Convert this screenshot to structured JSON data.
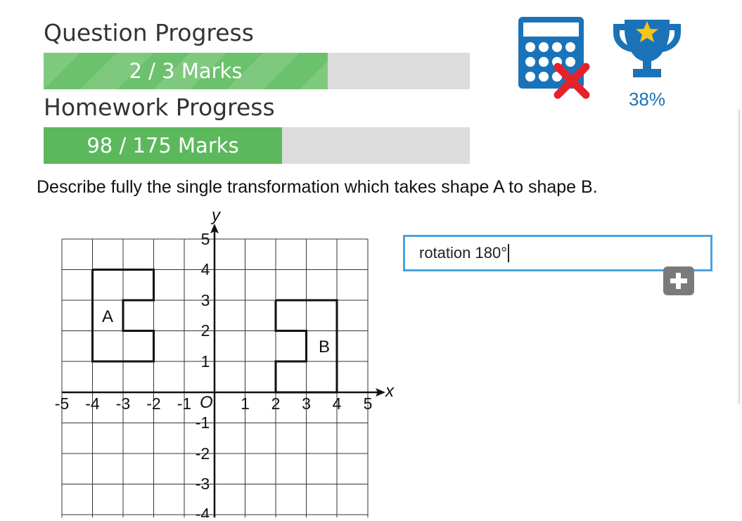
{
  "question_progress": {
    "label": "Question Progress",
    "text": "2 / 3 Marks",
    "fraction": 0.667
  },
  "homework_progress": {
    "label": "Homework Progress",
    "text": "98 / 175 Marks",
    "fraction": 0.56
  },
  "stats": {
    "score_percent": "38%"
  },
  "question": {
    "text": "Describe fully the single transformation which takes shape A to shape B."
  },
  "answer": {
    "value": "rotation 180°"
  },
  "graph": {
    "x_axis_label": "x",
    "y_axis_label": "y",
    "origin_label": "O",
    "x_ticks": [
      "-5",
      "-4",
      "-3",
      "-2",
      "-1",
      "1",
      "2",
      "3",
      "4",
      "5"
    ],
    "y_ticks": [
      "5",
      "4",
      "3",
      "2",
      "1",
      "-1",
      "-2",
      "-3",
      "-4"
    ],
    "shape_a_label": "A",
    "shape_b_label": "B"
  },
  "colors": {
    "progress_fill": "#5cb85c",
    "progress_track": "#dcdcdc",
    "accent_blue": "#1a73b8",
    "error_red": "#e8202a",
    "trophy_star": "#f5c518"
  },
  "icons": [
    "calculator-icon",
    "cross-icon",
    "trophy-icon",
    "star-icon",
    "plus-icon"
  ]
}
